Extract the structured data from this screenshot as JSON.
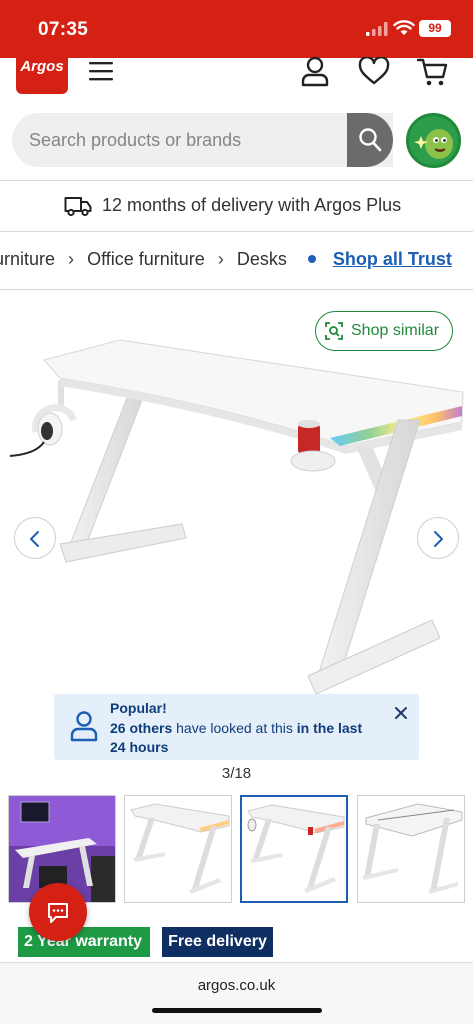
{
  "status_bar": {
    "time": "07:35",
    "battery": "99"
  },
  "header": {
    "logo_text": "Argos"
  },
  "search": {
    "placeholder": "Search products or brands"
  },
  "delivery_banner": {
    "text": "12 months of delivery with Argos Plus"
  },
  "breadcrumb": {
    "items": [
      "urniture",
      "Office furniture",
      "Desks"
    ],
    "link": "Shop all Trust"
  },
  "product": {
    "shop_similar_label": "Shop similar",
    "image_counter": "3/18",
    "popular": {
      "title": "Popular!",
      "count_text": "26 others",
      "middle_text": " have looked at this ",
      "time_text_1": "in the last",
      "time_text_2": "24 hours"
    }
  },
  "badges": {
    "warranty": "2 Year warranty",
    "delivery": "Free delivery"
  },
  "browser": {
    "url": "argos.co.uk"
  },
  "colors": {
    "brand_red": "#d42114",
    "link_blue": "#1d5fb3",
    "accent_green": "#1e8a3a",
    "notice_bg": "#e5effa",
    "delivery_badge": "#0f2f63"
  }
}
